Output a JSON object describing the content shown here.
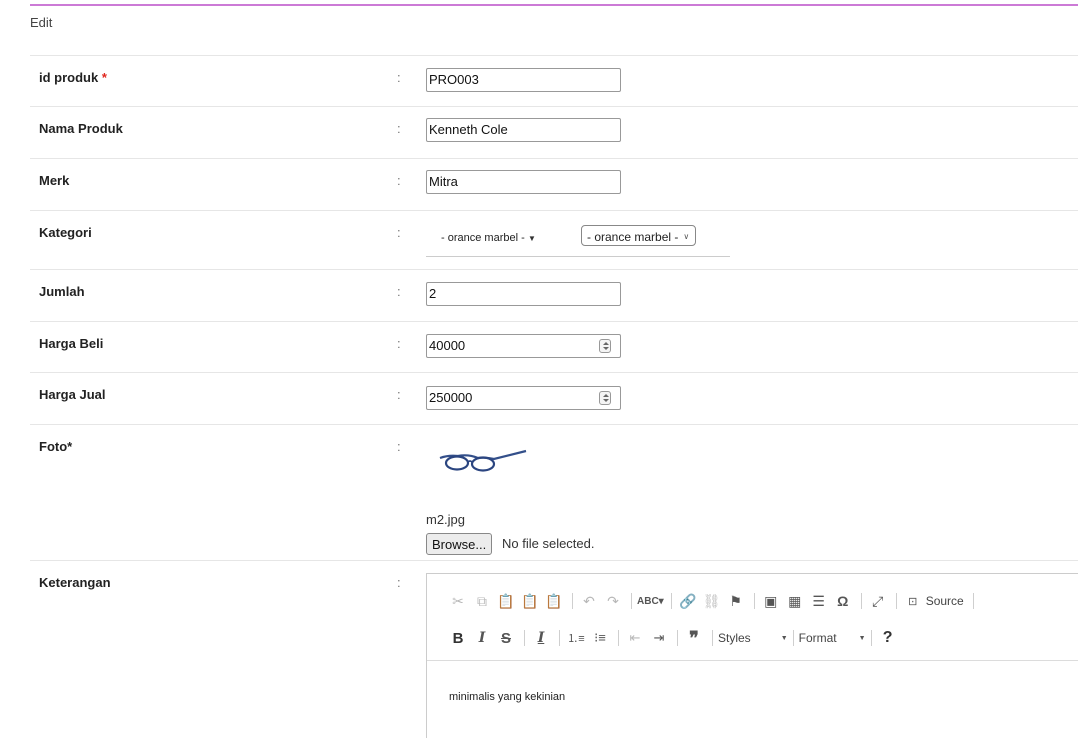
{
  "header": {
    "title": "Edit"
  },
  "form": {
    "separator": ":",
    "id_produk": {
      "label": "id produk",
      "required_mark": "*",
      "value": "PRO003"
    },
    "nama_produk": {
      "label": "Nama Produk",
      "value": "Kenneth Cole"
    },
    "merk": {
      "label": "Merk",
      "value": "Mitra"
    },
    "kategori": {
      "label": "Kategori",
      "display_value": "- orance marbel -",
      "select_value": "- orance marbel -"
    },
    "jumlah": {
      "label": "Jumlah",
      "value": "2"
    },
    "harga_beli": {
      "label": "Harga Beli",
      "value": "40000"
    },
    "harga_jual": {
      "label": "Harga Jual",
      "value": "250000"
    },
    "foto": {
      "label": "Foto*",
      "current_file": "m2.jpg",
      "browse_label": "Browse...",
      "no_file_text": "No file selected."
    },
    "keterangan": {
      "label": "Keterangan",
      "content": "minimalis yang kekinian",
      "toolbar": {
        "source_label": "Source",
        "styles_label": "Styles",
        "format_label": "Format",
        "help_label": "?",
        "icons_row1": [
          "cut-icon",
          "copy-icon",
          "paste-icon",
          "paste-text-icon",
          "paste-word-icon",
          "undo-icon",
          "redo-icon",
          "spellcheck-icon",
          "link-icon",
          "unlink-icon",
          "anchor-icon",
          "image-icon",
          "table-icon",
          "horizontal-line-icon",
          "special-char-icon",
          "maximize-icon",
          "source-icon"
        ],
        "icons_row2": [
          "bold-icon",
          "italic-icon",
          "strikethrough-icon",
          "remove-format-icon",
          "numbered-list-icon",
          "bulleted-list-icon",
          "outdent-icon",
          "indent-icon",
          "blockquote-icon"
        ]
      }
    }
  },
  "colors": {
    "accent_line": "#cc7ad6",
    "required": "#e0261e"
  }
}
